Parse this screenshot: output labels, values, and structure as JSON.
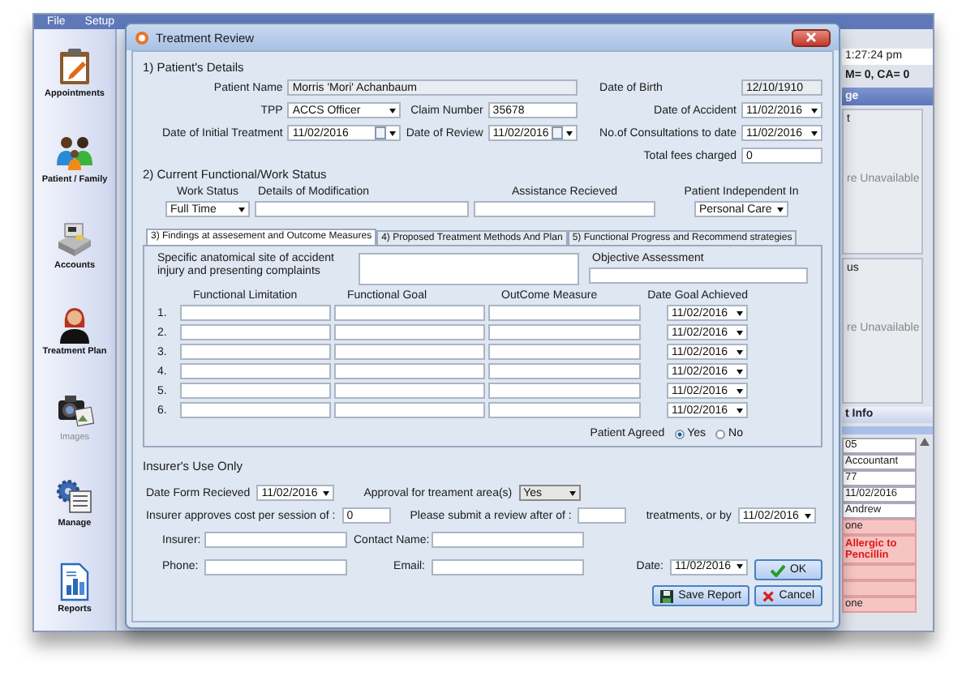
{
  "menu": [
    {
      "label": "File"
    },
    {
      "label": "Setup"
    }
  ],
  "sidebar": [
    {
      "label": "Appointments",
      "kind": "clipboard",
      "disabled": false
    },
    {
      "label": "Patient / Family",
      "kind": "people",
      "disabled": false
    },
    {
      "label": "Accounts",
      "kind": "register",
      "disabled": false
    },
    {
      "label": "Treatment Plan",
      "kind": "person",
      "disabled": false
    },
    {
      "label": "Images",
      "kind": "camera",
      "disabled": true
    },
    {
      "label": "Manage",
      "kind": "gear",
      "disabled": false
    },
    {
      "label": "Reports",
      "kind": "report",
      "disabled": false
    }
  ],
  "side_panel": {
    "clock": "1:27:24 pm",
    "counts": "M= 0, CA= 0",
    "header": "ge",
    "boxes": [
      {
        "title": "t",
        "message": "re Unavailable"
      },
      {
        "title": "us",
        "message": "re Unavailable"
      }
    ],
    "info_header": "t Info",
    "info_rows": [
      {
        "text": "05",
        "alert": false,
        "warning": false
      },
      {
        "text": "Accountant",
        "alert": false,
        "warning": false
      },
      {
        "text": "77",
        "alert": false,
        "warning": false
      },
      {
        "text": "11/02/2016",
        "alert": false,
        "warning": false
      },
      {
        "text": "Andrew",
        "alert": false,
        "warning": false
      },
      {
        "text": "one",
        "alert": true,
        "warning": false
      },
      {
        "text": "Allergic to Pencillin",
        "alert": true,
        "warning": true
      },
      {
        "alert": true,
        "warning": false
      },
      {
        "alert": true,
        "warning": false
      },
      {
        "text": "one",
        "alert": true,
        "warning": false
      }
    ]
  },
  "dialog": {
    "title": "Treatment Review",
    "patient": {
      "title": "1) Patient's  Details",
      "patient_name": {
        "label": "Patient Name",
        "value": "Morris 'Mori' Achanbaum",
        "kind": "readonly"
      },
      "date_of_birth": {
        "label": "Date of Birth",
        "value": "12/10/1910",
        "kind": "readonly"
      },
      "tpp": {
        "label": "TPP",
        "value": "ACCS Officer",
        "kind": "combo"
      },
      "claim_number": {
        "label": "Claim Number",
        "value": "35678",
        "kind": "text"
      },
      "date_of_accident": {
        "label": "Date of Accident",
        "value": "11/02/2016",
        "kind": "combo"
      },
      "date_of_initial_treatment": {
        "label": "Date of Initial Treatment",
        "value": "11/02/2016",
        "kind": "date"
      },
      "date_of_review": {
        "label": "Date of Review",
        "value": "11/02/2016",
        "kind": "date"
      },
      "consultations_to_date": {
        "label": "No.of Consultations to date",
        "value": "11/02/2016",
        "kind": "combo"
      },
      "total_fees": {
        "label": "Total fees charged",
        "value": "0",
        "kind": "text"
      }
    },
    "work": {
      "title": "2) Current Functional/Work Status",
      "work_status": {
        "label": "Work Status",
        "value": "Full Time",
        "kind": "combo"
      },
      "modification": {
        "label": "Details of Modification",
        "kind": "text"
      },
      "assistance": {
        "label": "Assistance Recieved",
        "kind": "text"
      },
      "independent_in": {
        "label": "Patient Independent In",
        "value": "Personal Care",
        "kind": "combo"
      }
    },
    "tabs": [
      {
        "label": "3) Findings at assesement and Outcome Measures",
        "selected": true
      },
      {
        "label": "4) Proposed Treatment Methods And Plan",
        "selected": false
      },
      {
        "label": "5) Functional Progress and Recommend strategies",
        "selected": false
      }
    ],
    "findings": {
      "injury_site": {
        "label": "Specific anatomical site of accident injury and presenting complaints",
        "kind": "text"
      },
      "objective": {
        "label": "Objective Assessment",
        "kind": "text"
      },
      "columns": [
        "Functional Limitation",
        "Functional Goal",
        "OutCome Measure",
        "Date Goal Achieved"
      ],
      "rows": [
        {
          "number": "1.",
          "date": "11/02/2016"
        },
        {
          "number": "2.",
          "date": "11/02/2016"
        },
        {
          "number": "3.",
          "date": "11/02/2016"
        },
        {
          "number": "4.",
          "date": "11/02/2016"
        },
        {
          "number": "5.",
          "date": "11/02/2016"
        },
        {
          "number": "6.",
          "date": "11/02/2016"
        }
      ],
      "patient_agreed": {
        "label": "Patient Agreed",
        "options": [
          {
            "label": "Yes",
            "selected": true
          },
          {
            "label": "No",
            "selected": false
          }
        ]
      }
    },
    "insurer": {
      "title": "Insurer's  Use Only",
      "date_received": {
        "label": "Date Form Recieved",
        "value": "11/02/2016",
        "kind": "combo"
      },
      "approval": {
        "label": "Approval for treament area(s)",
        "value": "Yes",
        "kind": "combo"
      },
      "cost": {
        "label": "Insurer approves cost per session of :",
        "value": "0",
        "kind": "text"
      },
      "review_after": {
        "label": "Please submit a review after of :",
        "kind": "text"
      },
      "review_by": {
        "label": "treatments, or by",
        "value": "11/02/2016",
        "kind": "combo"
      },
      "insurer": {
        "label": "Insurer:",
        "kind": "text"
      },
      "contact": {
        "label": "Contact Name:",
        "kind": "text"
      },
      "phone": {
        "label": "Phone:",
        "kind": "text"
      },
      "email": {
        "label": "Email:",
        "kind": "text"
      },
      "date": {
        "label": "Date:",
        "value": "11/02/2016",
        "kind": "combo"
      }
    },
    "buttons": [
      {
        "label": "OK",
        "kind": "ok"
      },
      {
        "label": "Save Report",
        "kind": "save"
      },
      {
        "label": "Cancel",
        "kind": "cancel"
      }
    ]
  }
}
